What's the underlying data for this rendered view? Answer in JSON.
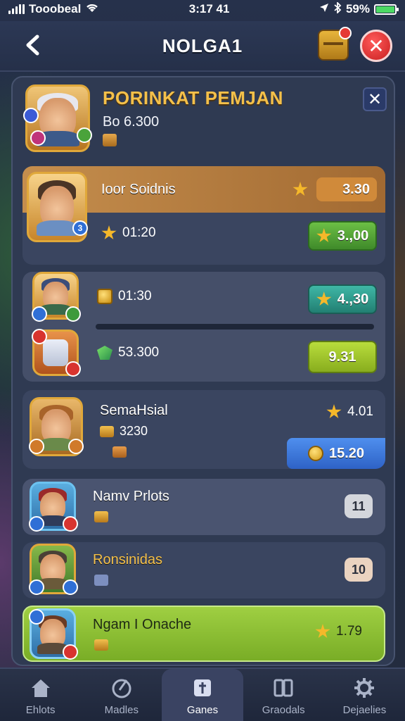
{
  "status_bar": {
    "carrier": "Tooobeal",
    "time": "3:17 41",
    "battery": "59%",
    "battery_level": 0.59
  },
  "header": {
    "title": "NOLGA1"
  },
  "panel": {
    "title": "PORINKAT PEMJAN",
    "subtitle": "Bo 6.300"
  },
  "rows": [
    {
      "name": "Ioor Soidnis",
      "score": "3.30",
      "time": "01:20",
      "reward": "3.,00",
      "level_badge": "3"
    },
    {
      "time": "01:30",
      "reward": "4.,30",
      "gems": "53.300",
      "reward2": "9.31"
    },
    {
      "name": "SemaHsial",
      "score": "4.01",
      "sub_value": "3230",
      "coins": "15.20"
    },
    {
      "name": "Namv Prlots",
      "count": "11"
    },
    {
      "name": "Ronsinidas",
      "count": "10"
    },
    {
      "name": "Ngam I Onache",
      "score": "1.79"
    }
  ],
  "nav": {
    "items": [
      {
        "label": "Ehlots",
        "icon": "home-icon"
      },
      {
        "label": "Madles",
        "icon": "compass-icon"
      },
      {
        "label": "Ganes",
        "icon": "game-tile-icon"
      },
      {
        "label": "Graodals",
        "icon": "cards-icon"
      },
      {
        "label": "Dejaelies",
        "icon": "gear-icon"
      }
    ],
    "active": "Ganes"
  },
  "colors": {
    "accent_gold": "#f4c04a",
    "highlight_row": "#b0783d",
    "green_pill": "#58a83a",
    "teal_pill": "#2f9a8a",
    "lime_pill": "#9bc92e",
    "blue_pill": "#3f7fe0",
    "active_row": "#8fc13a"
  }
}
